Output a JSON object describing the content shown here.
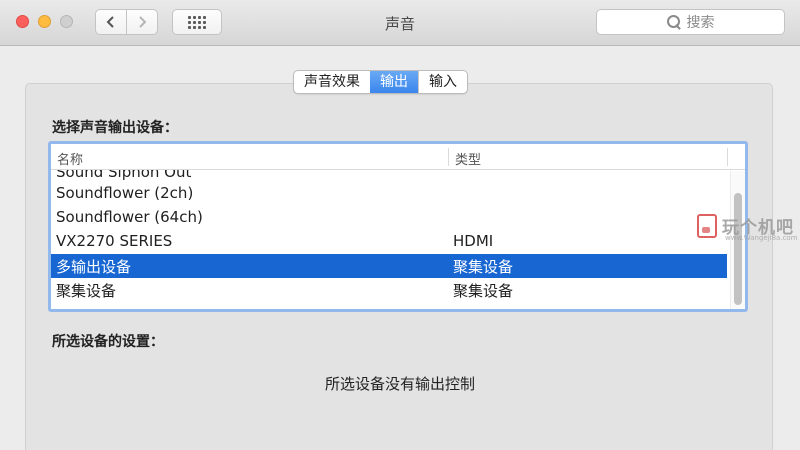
{
  "window": {
    "title": "声音",
    "search_placeholder": "搜索",
    "back_icon": "chevron-left-icon",
    "forward_icon": "chevron-right-icon",
    "grid_icon": "show-all-grid-icon",
    "search_icon": "magnifier-icon"
  },
  "tabs": [
    {
      "label": "声音效果",
      "active": false
    },
    {
      "label": "输出",
      "active": true
    },
    {
      "label": "输入",
      "active": false
    }
  ],
  "output": {
    "select_label": "选择声音输出设备：",
    "columns": {
      "name": "名称",
      "type": "类型"
    },
    "devices": [
      {
        "name": "Sound Siphon Out",
        "type": "",
        "selected": false
      },
      {
        "name": "Soundflower (2ch)",
        "type": "",
        "selected": false
      },
      {
        "name": "Soundflower (64ch)",
        "type": "",
        "selected": false
      },
      {
        "name": "VX2270 SERIES",
        "type": "HDMI",
        "selected": false
      },
      {
        "name": "多输出设备",
        "type": "聚集设备",
        "selected": true
      },
      {
        "name": "聚集设备",
        "type": "聚集设备",
        "selected": false
      }
    ],
    "settings_label": "所选设备的设置：",
    "no_control_text": "所选设备没有输出控制"
  },
  "watermark": {
    "text": "玩个机吧",
    "subtext": "www.Wangeji8a.com"
  },
  "colors": {
    "selection": "#1766d2",
    "tab_active": "#3a86ec",
    "focus_ring": "#93b8ec",
    "close": "#fc605c",
    "minimize": "#fdbc40"
  }
}
